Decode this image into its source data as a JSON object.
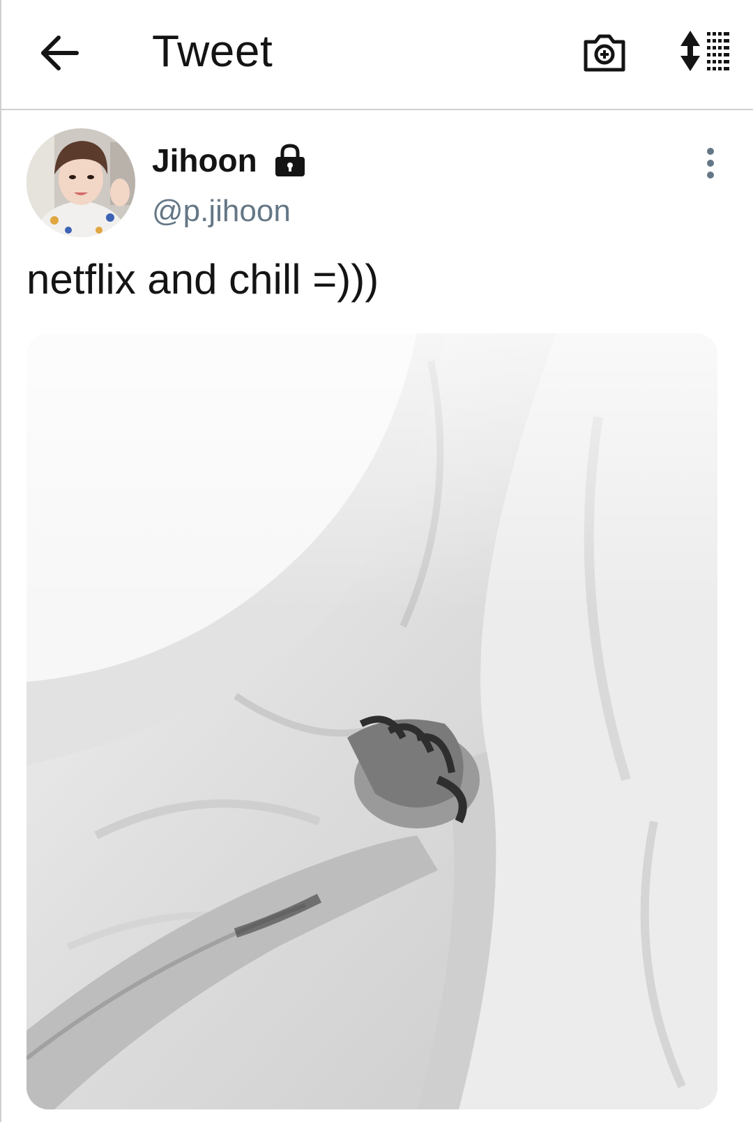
{
  "header": {
    "title": "Tweet",
    "back_icon": "arrow-left-icon",
    "camera_icon": "camera-plus-icon",
    "sort_icon": "sort-list-icon"
  },
  "tweet": {
    "author": {
      "display_name": "Jihoon",
      "handle": "@p.jihoon",
      "protected_icon": "lock-icon"
    },
    "more_icon": "vertical-dots-icon",
    "text": "netflix and chill =)))",
    "media_description_icon": "photo-image"
  },
  "colors": {
    "text_primary": "#141414",
    "text_secondary": "#657786",
    "divider": "#cfcfcf"
  }
}
